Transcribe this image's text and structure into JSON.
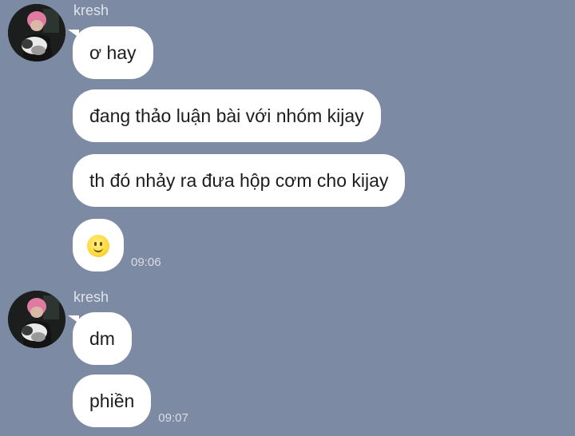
{
  "groups": [
    {
      "sender": "kresh",
      "messages": [
        {
          "text": "ơ hay"
        },
        {
          "text": "đang thảo luận bài với nhóm kijay"
        },
        {
          "text": "th đó nhảy ra đưa hộp cơm cho kijay"
        },
        {
          "emoji": "slightly-smiling-face",
          "time": "09:06"
        }
      ]
    },
    {
      "sender": "kresh",
      "messages": [
        {
          "text": "dm"
        },
        {
          "text": "phiền",
          "time": "09:07"
        }
      ]
    }
  ],
  "colors": {
    "background": "#7d8aa4",
    "bubble": "#ffffff",
    "meta_text": "#dfe3ea"
  }
}
